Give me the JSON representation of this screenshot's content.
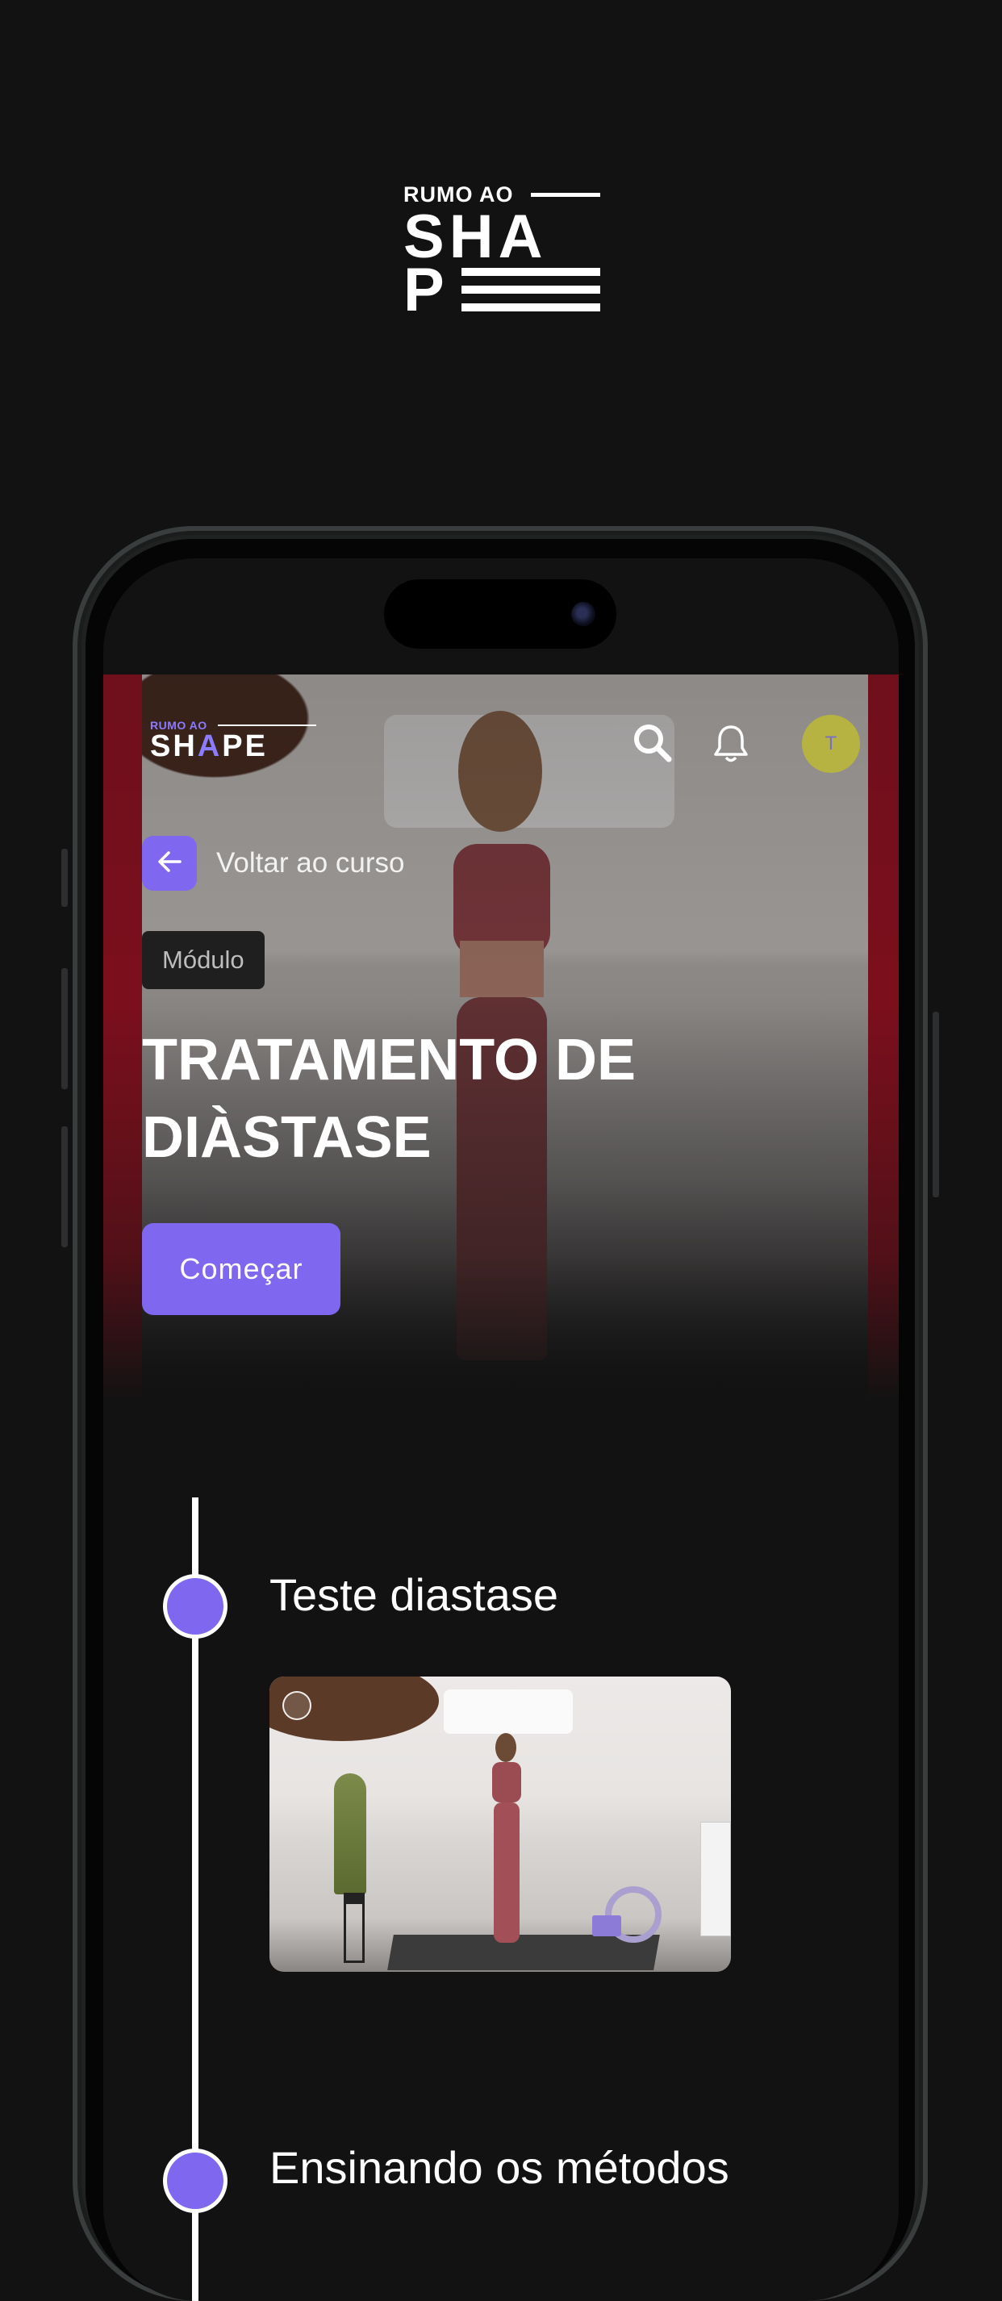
{
  "promo_logo": {
    "small_text": "RUMO AO",
    "line1": "SHA",
    "line2": "P"
  },
  "app": {
    "logo": {
      "small_text": "RUMO AO",
      "main_text": "SHAPE"
    },
    "header": {
      "search_icon": "search-icon",
      "bell_icon": "bell-icon",
      "avatar_initial": "T"
    },
    "hero": {
      "back_label": "Voltar ao curso",
      "badge": "Módulo",
      "title": "TRATAMENTO DE DIÀSTASE",
      "start_label": "Começar"
    },
    "lessons": [
      {
        "title": "Teste diastase"
      },
      {
        "title": "Ensinando os métodos"
      }
    ]
  },
  "colors": {
    "background": "#121212",
    "accent": "#7f67f0",
    "avatar": "#b7b342",
    "hero_side": "#a00e20"
  }
}
